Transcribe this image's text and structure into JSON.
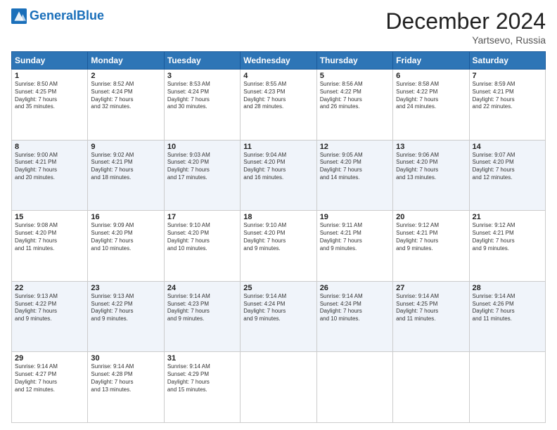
{
  "header": {
    "logo_general": "General",
    "logo_blue": "Blue",
    "month": "December 2024",
    "location": "Yartsevo, Russia"
  },
  "days_of_week": [
    "Sunday",
    "Monday",
    "Tuesday",
    "Wednesday",
    "Thursday",
    "Friday",
    "Saturday"
  ],
  "weeks": [
    [
      {
        "day": "1",
        "text": "Sunrise: 8:50 AM\nSunset: 4:25 PM\nDaylight: 7 hours\nand 35 minutes."
      },
      {
        "day": "2",
        "text": "Sunrise: 8:52 AM\nSunset: 4:24 PM\nDaylight: 7 hours\nand 32 minutes."
      },
      {
        "day": "3",
        "text": "Sunrise: 8:53 AM\nSunset: 4:24 PM\nDaylight: 7 hours\nand 30 minutes."
      },
      {
        "day": "4",
        "text": "Sunrise: 8:55 AM\nSunset: 4:23 PM\nDaylight: 7 hours\nand 28 minutes."
      },
      {
        "day": "5",
        "text": "Sunrise: 8:56 AM\nSunset: 4:22 PM\nDaylight: 7 hours\nand 26 minutes."
      },
      {
        "day": "6",
        "text": "Sunrise: 8:58 AM\nSunset: 4:22 PM\nDaylight: 7 hours\nand 24 minutes."
      },
      {
        "day": "7",
        "text": "Sunrise: 8:59 AM\nSunset: 4:21 PM\nDaylight: 7 hours\nand 22 minutes."
      }
    ],
    [
      {
        "day": "8",
        "text": "Sunrise: 9:00 AM\nSunset: 4:21 PM\nDaylight: 7 hours\nand 20 minutes."
      },
      {
        "day": "9",
        "text": "Sunrise: 9:02 AM\nSunset: 4:21 PM\nDaylight: 7 hours\nand 18 minutes."
      },
      {
        "day": "10",
        "text": "Sunrise: 9:03 AM\nSunset: 4:20 PM\nDaylight: 7 hours\nand 17 minutes."
      },
      {
        "day": "11",
        "text": "Sunrise: 9:04 AM\nSunset: 4:20 PM\nDaylight: 7 hours\nand 16 minutes."
      },
      {
        "day": "12",
        "text": "Sunrise: 9:05 AM\nSunset: 4:20 PM\nDaylight: 7 hours\nand 14 minutes."
      },
      {
        "day": "13",
        "text": "Sunrise: 9:06 AM\nSunset: 4:20 PM\nDaylight: 7 hours\nand 13 minutes."
      },
      {
        "day": "14",
        "text": "Sunrise: 9:07 AM\nSunset: 4:20 PM\nDaylight: 7 hours\nand 12 minutes."
      }
    ],
    [
      {
        "day": "15",
        "text": "Sunrise: 9:08 AM\nSunset: 4:20 PM\nDaylight: 7 hours\nand 11 minutes."
      },
      {
        "day": "16",
        "text": "Sunrise: 9:09 AM\nSunset: 4:20 PM\nDaylight: 7 hours\nand 10 minutes."
      },
      {
        "day": "17",
        "text": "Sunrise: 9:10 AM\nSunset: 4:20 PM\nDaylight: 7 hours\nand 10 minutes."
      },
      {
        "day": "18",
        "text": "Sunrise: 9:10 AM\nSunset: 4:20 PM\nDaylight: 7 hours\nand 9 minutes."
      },
      {
        "day": "19",
        "text": "Sunrise: 9:11 AM\nSunset: 4:21 PM\nDaylight: 7 hours\nand 9 minutes."
      },
      {
        "day": "20",
        "text": "Sunrise: 9:12 AM\nSunset: 4:21 PM\nDaylight: 7 hours\nand 9 minutes."
      },
      {
        "day": "21",
        "text": "Sunrise: 9:12 AM\nSunset: 4:21 PM\nDaylight: 7 hours\nand 9 minutes."
      }
    ],
    [
      {
        "day": "22",
        "text": "Sunrise: 9:13 AM\nSunset: 4:22 PM\nDaylight: 7 hours\nand 9 minutes."
      },
      {
        "day": "23",
        "text": "Sunrise: 9:13 AM\nSunset: 4:22 PM\nDaylight: 7 hours\nand 9 minutes."
      },
      {
        "day": "24",
        "text": "Sunrise: 9:14 AM\nSunset: 4:23 PM\nDaylight: 7 hours\nand 9 minutes."
      },
      {
        "day": "25",
        "text": "Sunrise: 9:14 AM\nSunset: 4:24 PM\nDaylight: 7 hours\nand 9 minutes."
      },
      {
        "day": "26",
        "text": "Sunrise: 9:14 AM\nSunset: 4:24 PM\nDaylight: 7 hours\nand 10 minutes."
      },
      {
        "day": "27",
        "text": "Sunrise: 9:14 AM\nSunset: 4:25 PM\nDaylight: 7 hours\nand 11 minutes."
      },
      {
        "day": "28",
        "text": "Sunrise: 9:14 AM\nSunset: 4:26 PM\nDaylight: 7 hours\nand 11 minutes."
      }
    ],
    [
      {
        "day": "29",
        "text": "Sunrise: 9:14 AM\nSunset: 4:27 PM\nDaylight: 7 hours\nand 12 minutes."
      },
      {
        "day": "30",
        "text": "Sunrise: 9:14 AM\nSunset: 4:28 PM\nDaylight: 7 hours\nand 13 minutes."
      },
      {
        "day": "31",
        "text": "Sunrise: 9:14 AM\nSunset: 4:29 PM\nDaylight: 7 hours\nand 15 minutes."
      },
      null,
      null,
      null,
      null
    ]
  ]
}
